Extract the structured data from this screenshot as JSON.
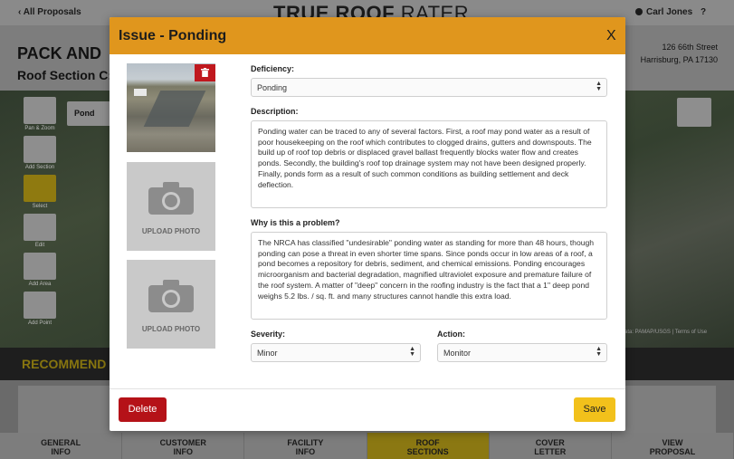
{
  "app": {
    "back_link": "All Proposals",
    "logo_bold": "TRUE ROOF",
    "logo_thin": "RATER",
    "user_name": "Carl Jones",
    "help": "?"
  },
  "project": {
    "title": "PACK AND",
    "section": "Roof Section C:",
    "address_line1": "126 66th Street",
    "address_line2": "Harrisburg, PA 17130"
  },
  "map": {
    "tools": [
      {
        "label": "Pan & Zoom",
        "icon": "hand-icon"
      },
      {
        "label": "Add Section",
        "icon": "add-section-icon"
      },
      {
        "label": "Select",
        "icon": "select-icon"
      },
      {
        "label": "Edit",
        "icon": "edit-icon"
      },
      {
        "label": "Add Area",
        "icon": "add-area-icon"
      },
      {
        "label": "Add Point",
        "icon": "add-point-icon"
      }
    ],
    "chip_label": "Pond",
    "attribution": "ata: PAMAP/USGS  |  Terms of Use"
  },
  "recommendations": {
    "title": "RECOMMEND"
  },
  "steps": [
    {
      "line1": "GENERAL",
      "line2": "INFO"
    },
    {
      "line1": "CUSTOMER",
      "line2": "INFO"
    },
    {
      "line1": "FACILITY",
      "line2": "INFO"
    },
    {
      "line1": "ROOF",
      "line2": "SECTIONS"
    },
    {
      "line1": "COVER",
      "line2": "LETTER"
    },
    {
      "line1": "VIEW",
      "line2": "PROPOSAL"
    }
  ],
  "modal": {
    "title": "Issue - Ponding",
    "close": "X",
    "upload_label": "UPLOAD PHOTO",
    "deficiency_label": "Deficiency:",
    "deficiency_value": "Ponding",
    "description_label": "Description:",
    "description_text": "Ponding water can be traced to any of several factors. First, a roof may pond water as a result of poor housekeeping on the roof which contributes to clogged drains, gutters and downspouts. The build up of roof top debris or displaced gravel ballast frequently blocks water flow and creates ponds. Secondly, the building's roof top drainage system may not have been designed properly. Finally, ponds form as a result of such common conditions as building settlement and deck deflection.",
    "why_label": "Why is this a problem?",
    "why_text": "The NRCA has classified \"undesirable\" ponding water as standing for more than 48 hours, though ponding can pose a threat in even shorter time spans. Since ponds occur in low areas of a roof, a pond becomes a repository for debris, sediment, and chemical emissions. Ponding encourages microorganism and bacterial degradation, magnified ultraviolet exposure and premature failure of the roof system. A matter of \"deep\" concern in the roofing industry is the fact that a 1\" deep pond weighs 5.2 lbs. / sq. ft. and many structures cannot handle this extra load.",
    "severity_label": "Severity:",
    "severity_value": "Minor",
    "action_label": "Action:",
    "action_value": "Monitor",
    "delete_label": "Delete",
    "save_label": "Save"
  },
  "colors": {
    "modal_header": "#e0961d",
    "delete": "#b51218",
    "save": "#f2c11b"
  }
}
